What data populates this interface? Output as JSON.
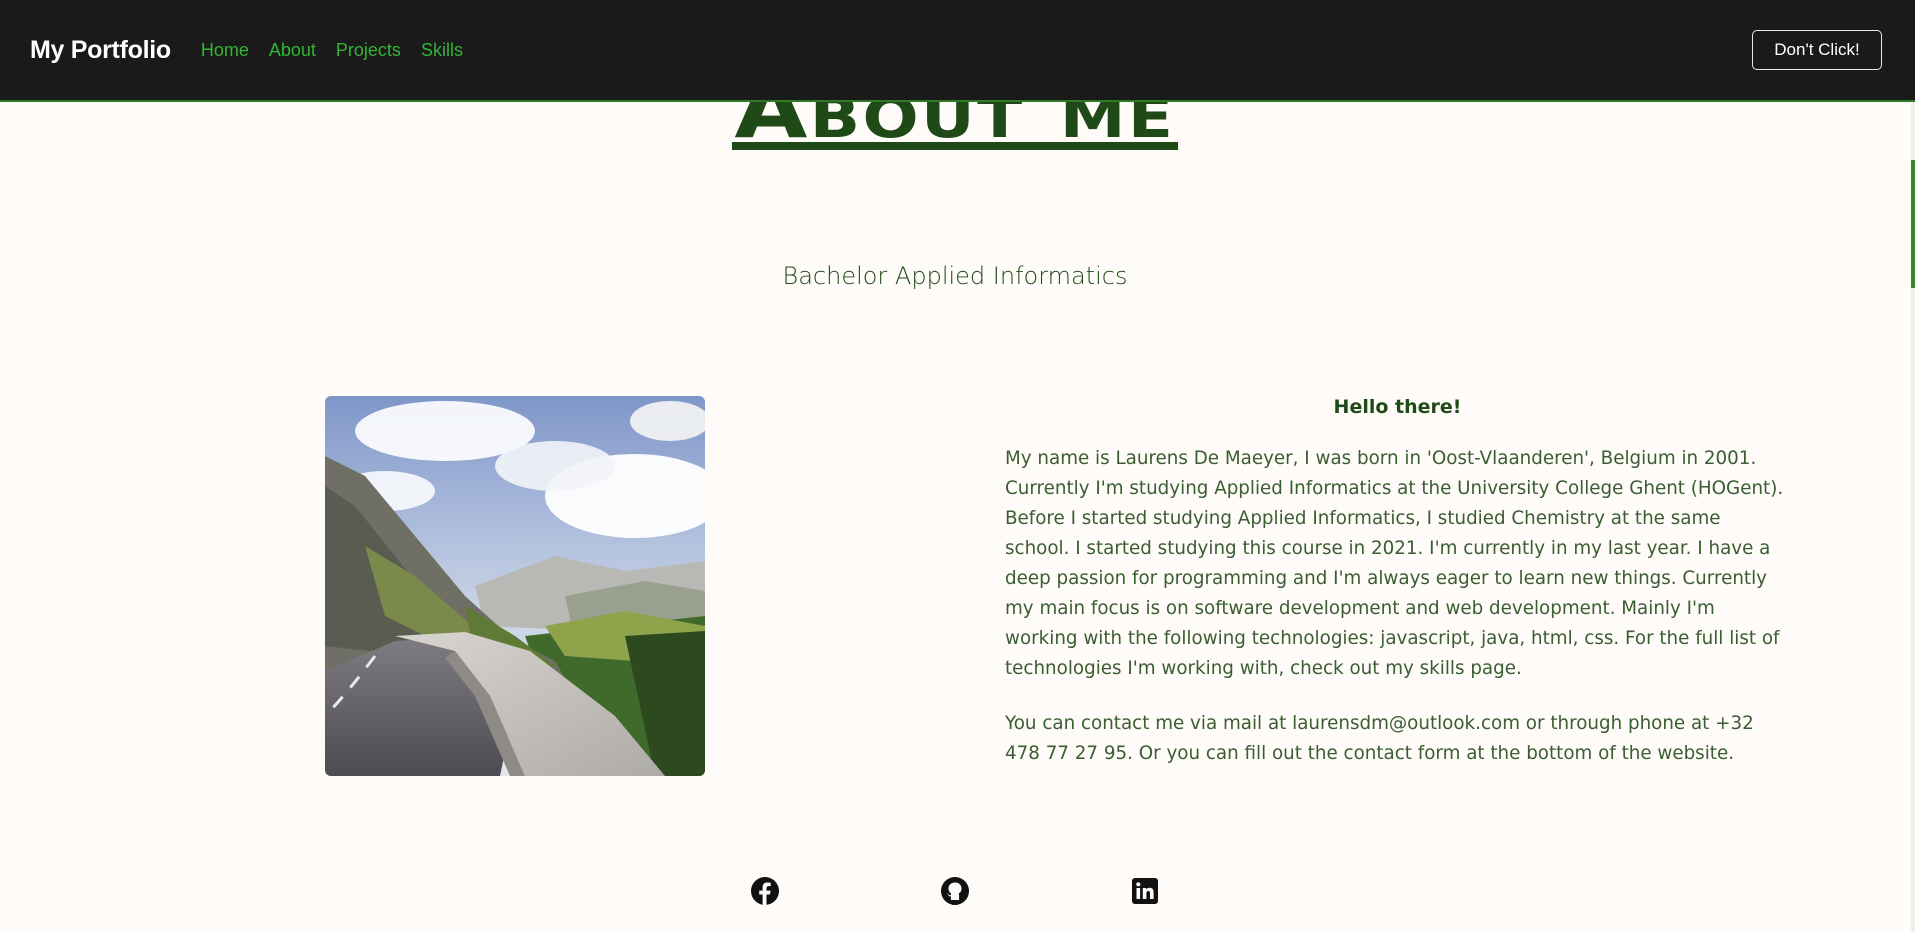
{
  "navbar": {
    "brand": "My Portfolio",
    "links": [
      "Home",
      "About",
      "Projects",
      "Skills"
    ],
    "button_label": "Don't Click!"
  },
  "about": {
    "title": "About me",
    "subtitle": "Bachelor Applied Informatics",
    "greeting": "Hello there!",
    "paragraph1": "My name is Laurens De Maeyer, I was born in 'Oost-Vlaanderen', Belgium in 2001. Currently I'm studying Applied Informatics at the University College Ghent (HOGent). Before I started studying Applied Informatics, I studied Chemistry at the same school. I started studying this course in 2021. I'm currently in my last year. I have a deep passion for programming and I'm always eager to learn new things. Currently my main focus is on software development and web development. Mainly I'm working with the following technologies: javascript, java, html, css. For the full list of technologies I'm working with, check out my skills page.",
    "paragraph2": "You can contact me via mail at laurensdm@outlook.com or through phone at +32 478 77 27 95. Or you can fill out the contact form at the bottom of the website."
  },
  "socials": [
    "facebook-icon",
    "github-icon",
    "linkedin-icon"
  ],
  "colors": {
    "navbar_bg": "#1a1a1a",
    "nav_link": "#33b533",
    "accent_dark_green": "#1f4a17",
    "page_bg": "#fefbf8"
  }
}
